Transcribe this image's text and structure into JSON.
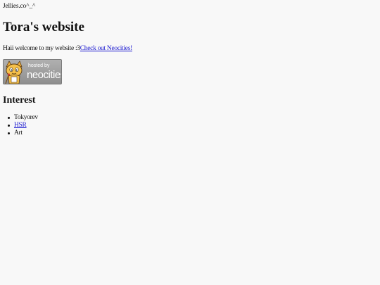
{
  "header": {
    "topline": "Jellies.co^_^"
  },
  "main": {
    "title": "Tora's website",
    "welcome_text": "Haii welcome to my website :3",
    "neocities_link": "Check out Neocities!",
    "badge": {
      "small_text": "hosted by",
      "big_text": "neocities",
      "icon": "neocities-cat-icon"
    },
    "interest_heading": "Interest",
    "interests": [
      {
        "label": "Tokyorev",
        "link": false
      },
      {
        "label": "HSR",
        "link": true
      },
      {
        "label": "Art",
        "link": false
      }
    ]
  },
  "colors": {
    "background": "#f8f8f8",
    "text": "#111111",
    "link": "#1a18d0",
    "badge_gray": "#a0a0a0"
  }
}
